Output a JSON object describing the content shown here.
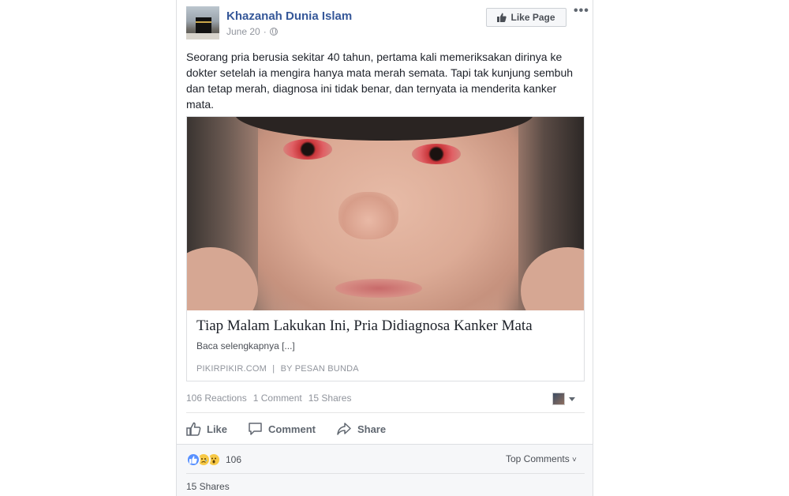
{
  "post": {
    "page_name": "Khazanah Dunia Islam",
    "date": "June 20",
    "separator": "·",
    "like_page_label": "Like Page",
    "more_label": "•••",
    "text": "Seorang pria berusia sekitar 40 tahun, pertama kali memeriksakan dirinya ke dokter setelah ia mengira hanya mata merah semata. Tapi tak kunjung sembuh dan tetap merah, diagnosa ini tidak benar, dan ternyata ia menderita kanker mata."
  },
  "link": {
    "title": "Tiap Malam Lakukan Ini, Pria Didiagnosa Kanker Mata",
    "description": "Baca selengkapnya [...]",
    "source": "PIKIRPIKIR.COM",
    "source_separator": "|",
    "byline": "BY PESAN BUNDA"
  },
  "stats": {
    "reactions": "106 Reactions",
    "comments": "1 Comment",
    "shares": "15 Shares"
  },
  "actions": {
    "like": "Like",
    "comment": "Comment",
    "share": "Share"
  },
  "comments_area": {
    "reaction_count": "106",
    "top_comments": "Top Comments",
    "top_comments_caret": "˅",
    "shares": "15 Shares"
  },
  "colors": {
    "link_blue": "#365899",
    "secondary_text": "#90949c",
    "like_reaction": "#5890ff",
    "emoji_yellow": "#f7c947"
  },
  "icons": {
    "globe": "globe-icon",
    "thumb": "thumbs-up-icon",
    "comment": "comment-icon",
    "share": "share-icon",
    "caret": "caret-down-icon"
  }
}
